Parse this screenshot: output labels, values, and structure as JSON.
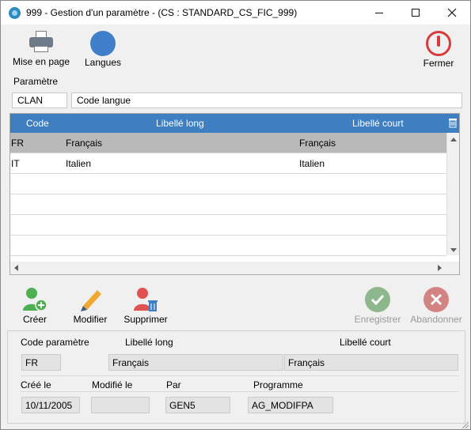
{
  "window": {
    "title": "999 - Gestion d'un paramètre - (CS : STANDARD_CS_FIC_999)"
  },
  "toolbar": {
    "print_label": "Mise en page",
    "languages_label": "Langues",
    "close_label": "Fermer"
  },
  "parameter": {
    "section_label": "Paramètre",
    "code": "CLAN",
    "label": "Code langue"
  },
  "grid": {
    "columns": [
      "Code",
      "Libellé long",
      "Libellé court"
    ],
    "rows": [
      {
        "code": "FR",
        "long": "Français",
        "short": "Français",
        "selected": true
      },
      {
        "code": "IT",
        "long": "Italien",
        "short": "Italien",
        "selected": false
      }
    ]
  },
  "actions": {
    "create": "Créer",
    "modify": "Modifier",
    "delete": "Supprimer",
    "save": "Enregistrer",
    "cancel": "Abandonner"
  },
  "details": {
    "code_label": "Code paramètre",
    "long_label": "Libellé long",
    "short_label": "Libellé court",
    "code_value": "FR",
    "long_value": "Français",
    "short_value": "Français",
    "created_label": "Créé le",
    "modified_label": "Modifié le",
    "by_label": "Par",
    "program_label": "Programme",
    "created_value": "10/11/2005",
    "modified_value": "",
    "by_value": "GEN5",
    "program_value": "AG_MODIFPA"
  },
  "colors": {
    "accent": "#3d7fc1",
    "create_green": "#4caf50",
    "modify_orange": "#f0a830",
    "delete_red": "#e05252",
    "save_disabled": "#8db88d",
    "cancel_disabled": "#d48383",
    "close_red": "#d73b3b"
  },
  "icons": {
    "app": "app-icon",
    "print": "printer-icon",
    "languages": "globe-icon",
    "close": "power-icon",
    "create": "add-user-icon",
    "modify": "pencil-icon",
    "delete": "delete-user-icon",
    "save": "check-icon",
    "cancel": "cross-icon",
    "column_chooser": "column-chooser-icon"
  }
}
